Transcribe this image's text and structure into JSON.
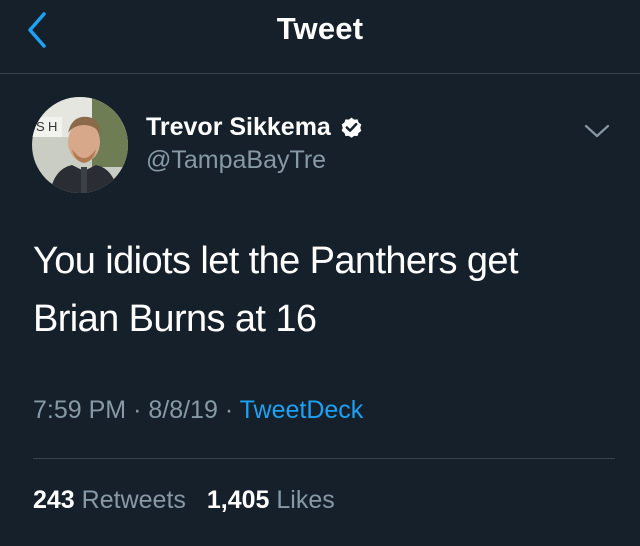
{
  "header": {
    "title": "Tweet",
    "back_icon": "chevron-left-icon"
  },
  "author": {
    "display_name": "Trevor Sikkema",
    "handle": "@TampaBayTre",
    "verified": true,
    "verified_icon": "verified-badge-icon",
    "more_icon": "chevron-down-icon",
    "avatar_sign_text": "SH"
  },
  "tweet": {
    "text": "You idiots let the Panthers get Brian Burns at 16",
    "time": "7:59 PM",
    "date": "8/8/19",
    "separator": "·",
    "source": "TweetDeck"
  },
  "stats": {
    "retweets_count": "243",
    "retweets_label": "Retweets",
    "likes_count": "1,405",
    "likes_label": "Likes"
  },
  "colors": {
    "background": "#15202b",
    "divider": "#38444d",
    "secondary_text": "#8899a6",
    "accent": "#1da1f2",
    "primary_text": "#ffffff"
  }
}
